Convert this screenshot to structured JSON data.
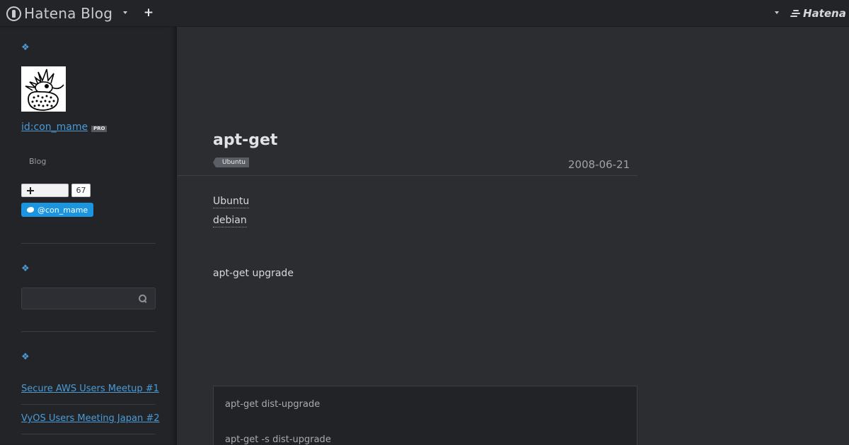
{
  "topbar": {
    "logo_text": "Hatena Blog",
    "plus": "+",
    "brand": "Hatena"
  },
  "sidebar": {
    "section_icon": "❖",
    "profile": {
      "user_id": "id:con_mame",
      "badge": "PRO",
      "blog_label": "Blog"
    },
    "bookmark": {
      "count": "67"
    },
    "twitter": {
      "handle": "@con_mame"
    },
    "search": {
      "value": "",
      "placeholder": ""
    },
    "entries": [
      "Secure AWS Users Meetup #1",
      "VyOS Users Meeting Japan #2"
    ]
  },
  "post": {
    "title": "apt-get",
    "category": "Ubuntu",
    "date": "2008-06-21",
    "keywords": [
      "Ubuntu",
      "debian"
    ],
    "body": "apt-get upgrade",
    "code": [
      "apt-get dist-upgrade",
      "apt-get -s dist-upgrade"
    ]
  },
  "colors": {
    "accent": "#4a9bd6",
    "twitter": "#1b95e0",
    "background": "#2b2d31",
    "sidebar": "#232427"
  },
  "icons": [
    "hatena-blog-logo-icon",
    "chevron-down-icon",
    "plus-icon",
    "hatena-logo-icon",
    "section-icon",
    "bookmark-plus-icon",
    "twitter-bird-icon",
    "search-icon"
  ]
}
